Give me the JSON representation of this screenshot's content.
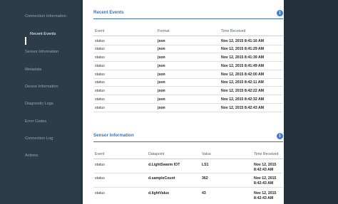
{
  "sidebar": {
    "items": [
      {
        "label": "Connection Information"
      },
      {
        "label": "Recent Events"
      },
      {
        "label": "Sensor Information"
      },
      {
        "label": "Metadata"
      },
      {
        "label": "Device Information"
      },
      {
        "label": "Diagnostic Logs"
      },
      {
        "label": "Error Codes"
      },
      {
        "label": "Connection Log"
      },
      {
        "label": "Actions"
      }
    ]
  },
  "recent_events": {
    "title": "Recent Events",
    "columns": [
      "Event",
      "Format",
      "Time Received"
    ],
    "rows": [
      {
        "event": "status",
        "format": "json",
        "time": "Nov 12, 2015 8:41:16 AM"
      },
      {
        "event": "status",
        "format": "json",
        "time": "Nov 12, 2015 8:41:29 AM"
      },
      {
        "event": "status",
        "format": "json",
        "time": "Nov 12, 2015 8:41:39 AM"
      },
      {
        "event": "status",
        "format": "json",
        "time": "Nov 12, 2015 8:41:49 AM"
      },
      {
        "event": "status",
        "format": "json",
        "time": "Nov 12, 2015 8:42:00 AM"
      },
      {
        "event": "status",
        "format": "json",
        "time": "Nov 12, 2015 8:42:11 AM"
      },
      {
        "event": "status",
        "format": "json",
        "time": "Nov 12, 2015 8:42:22 AM"
      },
      {
        "event": "status",
        "format": "json",
        "time": "Nov 12, 2015 8:42:32 AM"
      },
      {
        "event": "status",
        "format": "json",
        "time": "Nov 12, 2015 8:42:43 AM"
      }
    ]
  },
  "sensor_info": {
    "title": "Sensor Information",
    "columns": [
      "Event",
      "Datapoint",
      "Value",
      "Time Received"
    ],
    "rows": [
      {
        "event": "status",
        "datapoint": "d.LightSwarm IOT",
        "value": "LS1",
        "time_line1": "Nov 12, 2015",
        "time_line2": "8:42:43 AM"
      },
      {
        "event": "status",
        "datapoint": "d.sampleCount",
        "value": "362",
        "time_line1": "Nov 12, 2015",
        "time_line2": "8:42:43 AM"
      },
      {
        "event": "status",
        "datapoint": "d.lightValue",
        "value": "43",
        "time_line1": "Nov 12, 2015",
        "time_line2": "8:42:43 AM"
      }
    ]
  },
  "colors": {
    "accent": "#3b6fb3",
    "info_icon": "#3b7fd1",
    "sidebar_bg": "#2c3c48"
  },
  "icons": {
    "info": "info-icon",
    "info_glyph": "i"
  }
}
